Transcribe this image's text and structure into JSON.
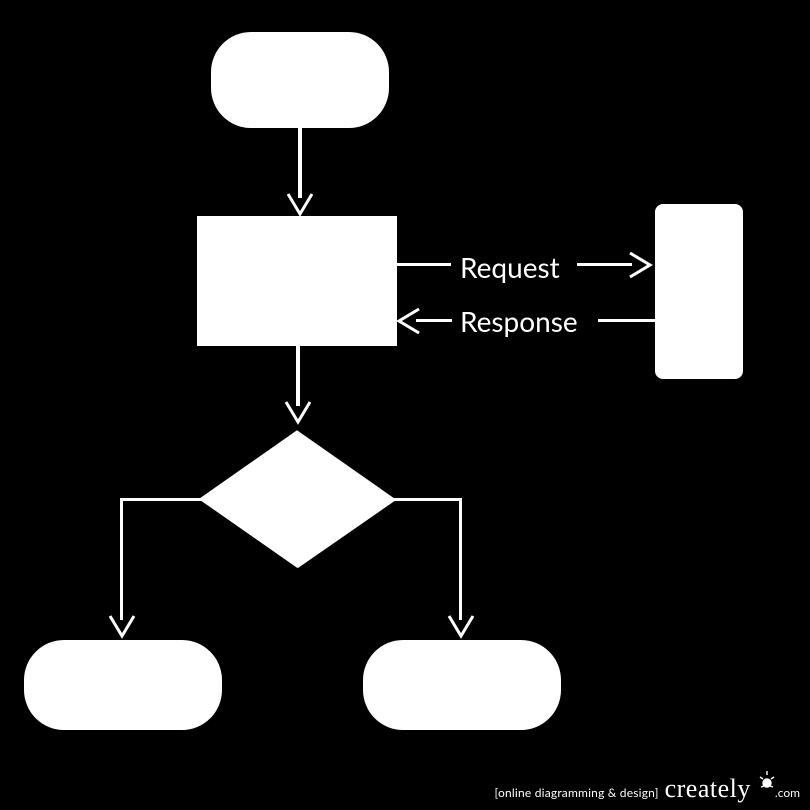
{
  "nodes": {
    "start": {
      "type": "terminator"
    },
    "process": {
      "type": "process"
    },
    "server": {
      "type": "rect"
    },
    "decision": {
      "type": "decision"
    },
    "endLeft": {
      "type": "terminator"
    },
    "endRight": {
      "type": "terminator"
    }
  },
  "edges": {
    "request_label": "Request",
    "response_label": "Response"
  },
  "footer": {
    "tagline": "[online diagramming & design]",
    "brand": "creately",
    "domain": ".com"
  }
}
